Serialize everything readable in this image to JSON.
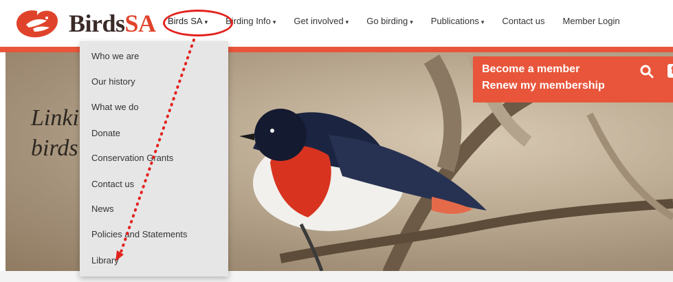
{
  "logo": {
    "text_main": "Birds",
    "text_accent": "SA"
  },
  "nav": {
    "items": [
      {
        "label": "Birds SA",
        "caret": "▾"
      },
      {
        "label": "Birding Info",
        "caret": "▾"
      },
      {
        "label": "Get involved",
        "caret": "▾"
      },
      {
        "label": "Go birding",
        "caret": "▾"
      },
      {
        "label": "Publications",
        "caret": "▾"
      },
      {
        "label": "Contact us"
      },
      {
        "label": "Member Login"
      }
    ]
  },
  "dropdown": {
    "items": [
      "Who we are",
      "Our history",
      "What we do",
      "Donate",
      "Conservation Grants",
      "Contact us",
      "News",
      "Policies and Statements",
      "Library"
    ]
  },
  "hero": {
    "line1": "Linking people with",
    "line2": "birds"
  },
  "member_box": {
    "become": "Become a member",
    "renew": "Renew my membership",
    "icons": [
      "search-icon",
      "facebook-icon"
    ]
  },
  "colors": {
    "brand_red": "#e8553a",
    "annotation_red": "#e2221e",
    "logo_dark": "#3a2a28"
  }
}
